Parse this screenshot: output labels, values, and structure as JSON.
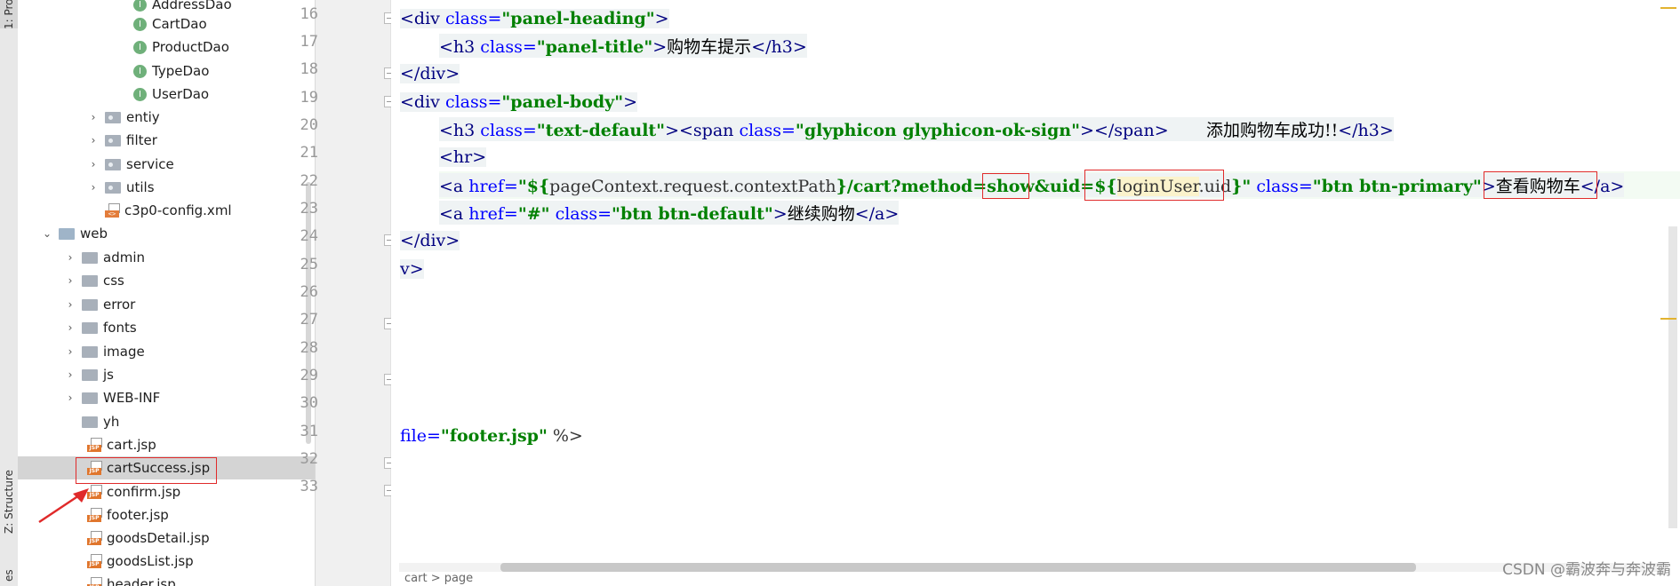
{
  "side_panel": {
    "project_tab": "1: Pro",
    "structure_tab": "Z: Structure",
    "bottom_tab": "es"
  },
  "tree": {
    "dao_items": [
      {
        "label": "AddressDao",
        "icon_letter": "I"
      },
      {
        "label": "CartDao",
        "icon_letter": "I"
      },
      {
        "label": "ProductDao",
        "icon_letter": "I"
      },
      {
        "label": "TypeDao",
        "icon_letter": "I"
      },
      {
        "label": "UserDao",
        "icon_letter": "I"
      }
    ],
    "packages": [
      "entiy",
      "filter",
      "service",
      "utils"
    ],
    "config_file": "c3p0-config.xml",
    "web_folder": "web",
    "web_folders": [
      "admin",
      "css",
      "error",
      "fonts",
      "image",
      "js",
      "WEB-INF"
    ],
    "plain_folder": "yh",
    "jsp_files": [
      "cart.jsp",
      "cartSuccess.jsp",
      "confirm.jsp",
      "footer.jsp",
      "goodsDetail.jsp",
      "goodsList.jsp",
      "header.jsp"
    ],
    "selected_file": "cartSuccess.jsp",
    "jsp_tag": "JSP",
    "xml_tag": "<>",
    "chevron_right": "›",
    "chevron_down": "⌄"
  },
  "editor": {
    "line_numbers": [
      "16",
      "17",
      "18",
      "19",
      "20",
      "21",
      "22",
      "23",
      "24",
      "25",
      "26",
      "27",
      "28",
      "29",
      "30",
      "31",
      "32",
      "33"
    ],
    "l16": {
      "t1": "<div ",
      "a1": "class=",
      "s1": "\"panel-heading\"",
      "t2": ">"
    },
    "l17": {
      "t1": "<h3 ",
      "a1": "class=",
      "s1": "\"panel-title\"",
      "t2": ">",
      "text": "购物车提示",
      "t3": "</h3>"
    },
    "l18": {
      "t1": "</div>"
    },
    "l19": {
      "t1": "<div ",
      "a1": "class=",
      "s1": "\"panel-body\"",
      "t2": ">"
    },
    "l20": {
      "t1": "<h3 ",
      "a1": "class=",
      "s1": "\"text-default\"",
      "t2": "><span ",
      "a2": "class=",
      "s2": "\"glyphicon glyphicon-ok-sign\"",
      "t3": "></span>",
      "pad": "       ",
      "text": "添加购物车成功!!",
      "t4": "</h3>"
    },
    "l21": {
      "t1": "<hr>"
    },
    "l22": {
      "t1": "<a ",
      "a1": "href=",
      "s1": "\"",
      "s2": "${",
      "ex1": "pageContext.request.contextPath",
      "s3": "}/cart?method=",
      "s4": "show",
      "s5": "&uid=",
      "s6": "${",
      "ex2": "loginUser",
      "ex3": ".uid",
      "s7": "}\"",
      "a2": " class=",
      "s8": "\"btn btn-primary\"",
      "t2": ">",
      "text": "查看购物车",
      "t3": "</a>"
    },
    "l23": {
      "t1": "<a ",
      "a1": "href=",
      "s1": "\"#\"",
      "a2": " class=",
      "s2": "\"btn btn-default\"",
      "t2": ">",
      "text": "继续购物",
      "t3": "</a>"
    },
    "l24": {
      "t1": "</div>"
    },
    "l25": {
      "t1": "v>"
    },
    "l31": {
      "a1": "file=",
      "s1": "\"footer.jsp\"",
      "t1": " %>"
    },
    "bottom_breadcrumb": "cart  >  page"
  },
  "watermark": "CSDN @霸波奔与奔波霸",
  "colors": {
    "tag": "#000080",
    "attr": "#0000ff",
    "string": "#008000",
    "annotation": "#e02a2a"
  }
}
